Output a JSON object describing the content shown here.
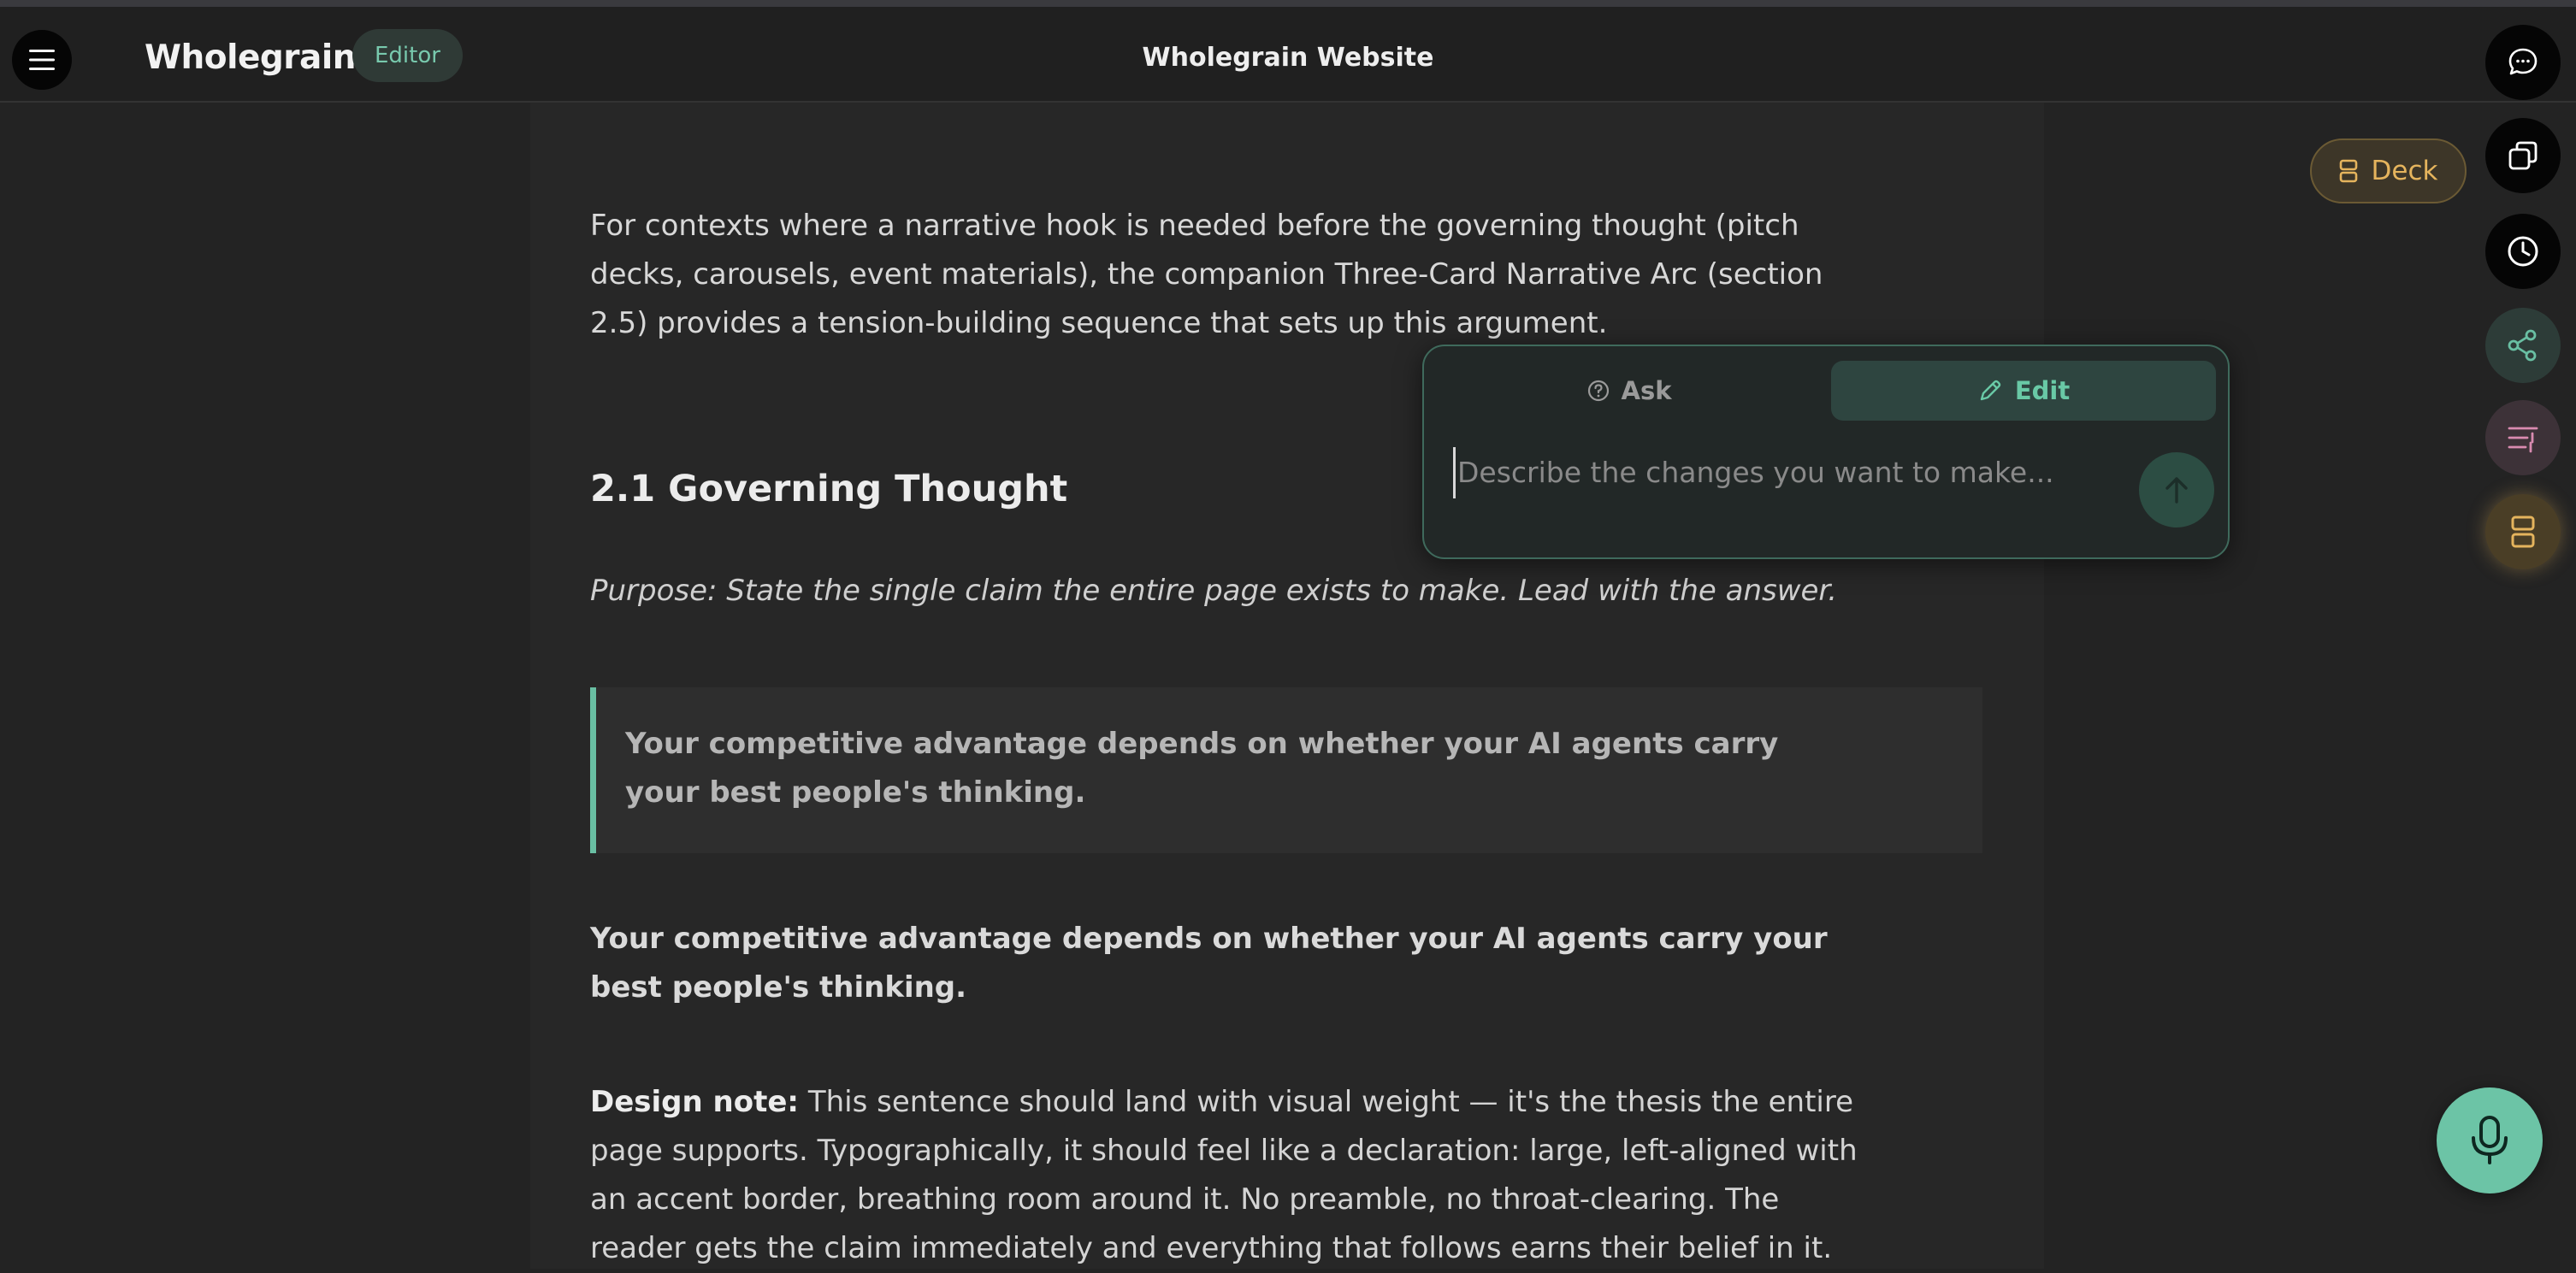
{
  "header": {
    "brand": "Wholegrain",
    "badge": "Editor",
    "doc_title": "Wholegrain Website"
  },
  "content": {
    "intro": "For contexts where a narrative hook is needed before the governing thought (pitch decks, carousels, event materials), the companion Three-Card Narrative Arc (section 2.5) provides a tension-building sequence that sets up this argument.",
    "heading": "2.1 Governing Thought",
    "purpose": "Purpose: State the single claim the entire page exists to make. Lead with the answer.",
    "callout": "Your competitive advantage depends on whether your AI agents carry your best people's thinking.",
    "bold_statement": "Your competitive advantage depends on whether your AI agents carry your best people's thinking.",
    "design_note_label": "Design note:",
    "design_note_text": " This sentence should land with visual weight — it's the thesis the entire page supports. Typographically, it should feel like a declaration: large, left-aligned with an accent border, breathing room around it. No preamble, no throat-clearing. The reader gets the claim immediately and everything that follows earns their belief in it."
  },
  "popover": {
    "ask_label": "Ask",
    "edit_label": "Edit",
    "active_mode": "Edit",
    "input_placeholder": "Describe the changes you want to make..."
  },
  "rail": {
    "deck_label": "Deck",
    "icons": [
      "chat-icon",
      "copy-icon",
      "history-icon",
      "share-icon",
      "settings-sliders-icon",
      "deck-icon"
    ]
  },
  "colors": {
    "accent": "#69bfa3",
    "deck": "#e5b45d",
    "settings": "#d98bb0"
  }
}
